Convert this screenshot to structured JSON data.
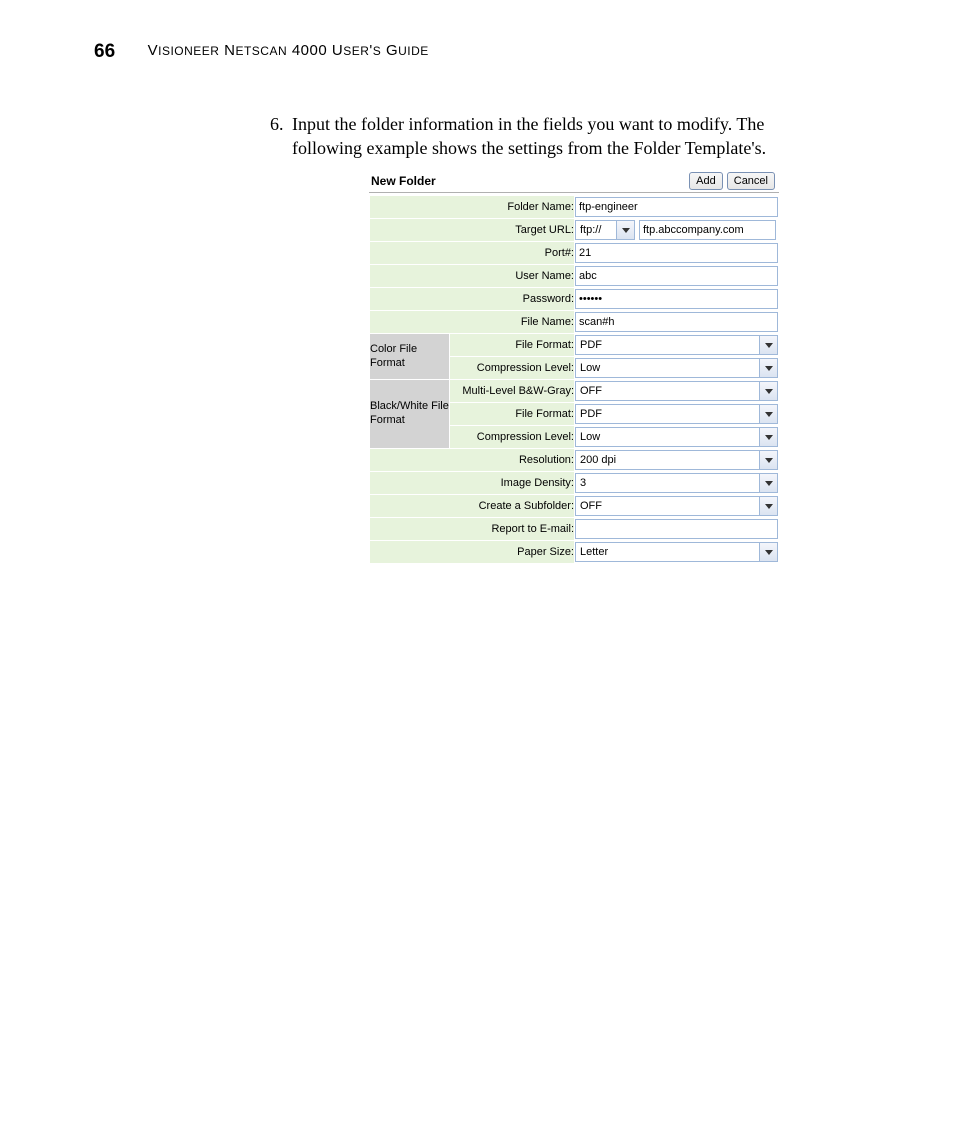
{
  "header": {
    "page_number": "66",
    "title_parts": [
      "V",
      "ISIONEER",
      " N",
      "ETSCAN",
      " 4000 U",
      "SER",
      "'",
      "S",
      " G",
      "UIDE"
    ]
  },
  "step": {
    "number": "6.",
    "text": "Input the folder information in the fields you want to modify. The following example shows the settings from the Folder Template's."
  },
  "panel": {
    "title": "New Folder",
    "add_label": "Add",
    "cancel_label": "Cancel",
    "labels": {
      "folder_name": "Folder Name:",
      "target_url": "Target URL:",
      "port": "Port#:",
      "user_name": "User Name:",
      "password": "Password:",
      "file_name": "File Name:",
      "file_format": "File Format:",
      "compression_level": "Compression Level:",
      "multi_level": "Multi-Level B&W-Gray:",
      "resolution": "Resolution:",
      "image_density": "Image Density:",
      "create_subfolder": "Create a Subfolder:",
      "report_email": "Report to E-mail:",
      "paper_size": "Paper Size:",
      "color_side": "Color File Format",
      "bw_side": "Black/White File Format"
    },
    "values": {
      "folder_name": "ftp-engineer",
      "target_url_scheme": "ftp://",
      "target_url_host": "ftp.abccompany.com",
      "port": "21",
      "user_name": "abc",
      "password": "••••••",
      "file_name": "scan#h",
      "color_file_format": "PDF",
      "color_compression": "Low",
      "bw_multi_level": "OFF",
      "bw_file_format": "PDF",
      "bw_compression": "Low",
      "resolution": "200 dpi",
      "image_density": "3",
      "create_subfolder": "OFF",
      "report_email": "",
      "paper_size": "Letter"
    }
  }
}
